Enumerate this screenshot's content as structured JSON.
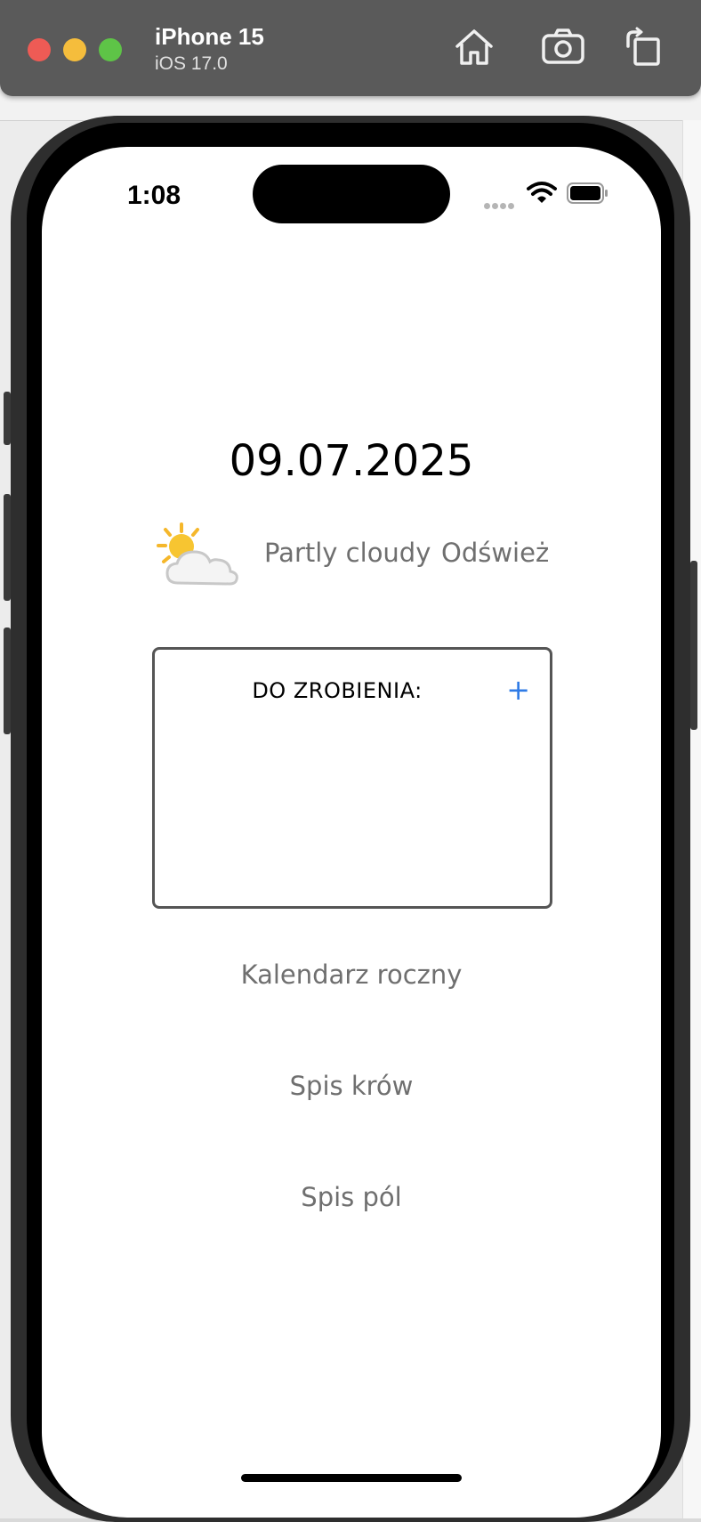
{
  "simulator": {
    "device_name": "iPhone 15",
    "os_version": "iOS 17.0",
    "buttons": {
      "home": "home-icon",
      "screenshot": "camera-icon",
      "rotate": "rotate-icon"
    }
  },
  "status_bar": {
    "time": "1:08"
  },
  "main": {
    "date": "09.07.2025",
    "weather": {
      "icon": "partly-cloudy-icon",
      "description": "Partly cloudy",
      "refresh_label": "Odśwież"
    },
    "todo": {
      "title": "DO ZROBIENIA:",
      "add_label": "+",
      "items": []
    },
    "nav": {
      "calendar": "Kalendarz roczny",
      "cows": "Spis krów",
      "fields": "Spis pól"
    }
  },
  "colors": {
    "accent": "#2f7be6",
    "link_text": "#6f6f6f",
    "border": "#555555"
  }
}
